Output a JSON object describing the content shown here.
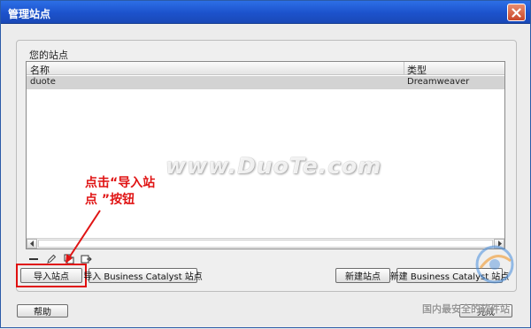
{
  "window": {
    "title": "管理站点"
  },
  "sites_panel": {
    "title": "您的站点",
    "columns": {
      "name": "名称",
      "type": "类型"
    },
    "rows": [
      {
        "name": "duote",
        "type": "Dreamweaver"
      }
    ]
  },
  "toolbar": {
    "icons": [
      "minus-icon",
      "pencil-icon",
      "duplicate-icon",
      "export-icon"
    ]
  },
  "buttons": {
    "import_site": "导入站点",
    "import_bc_site": "导入 Business Catalyst 站点",
    "new_site": "新建站点",
    "new_bc_site": "新建 Business Catalyst 站点",
    "help": "帮助",
    "done": "完成"
  },
  "annotation": {
    "text_line1": "点击“导入站",
    "text_line2": "点 ”按钮",
    "color": "#e01414"
  },
  "watermark": {
    "text": "www.DuoTe.com",
    "corner_text": "国内最安全的软件站"
  }
}
